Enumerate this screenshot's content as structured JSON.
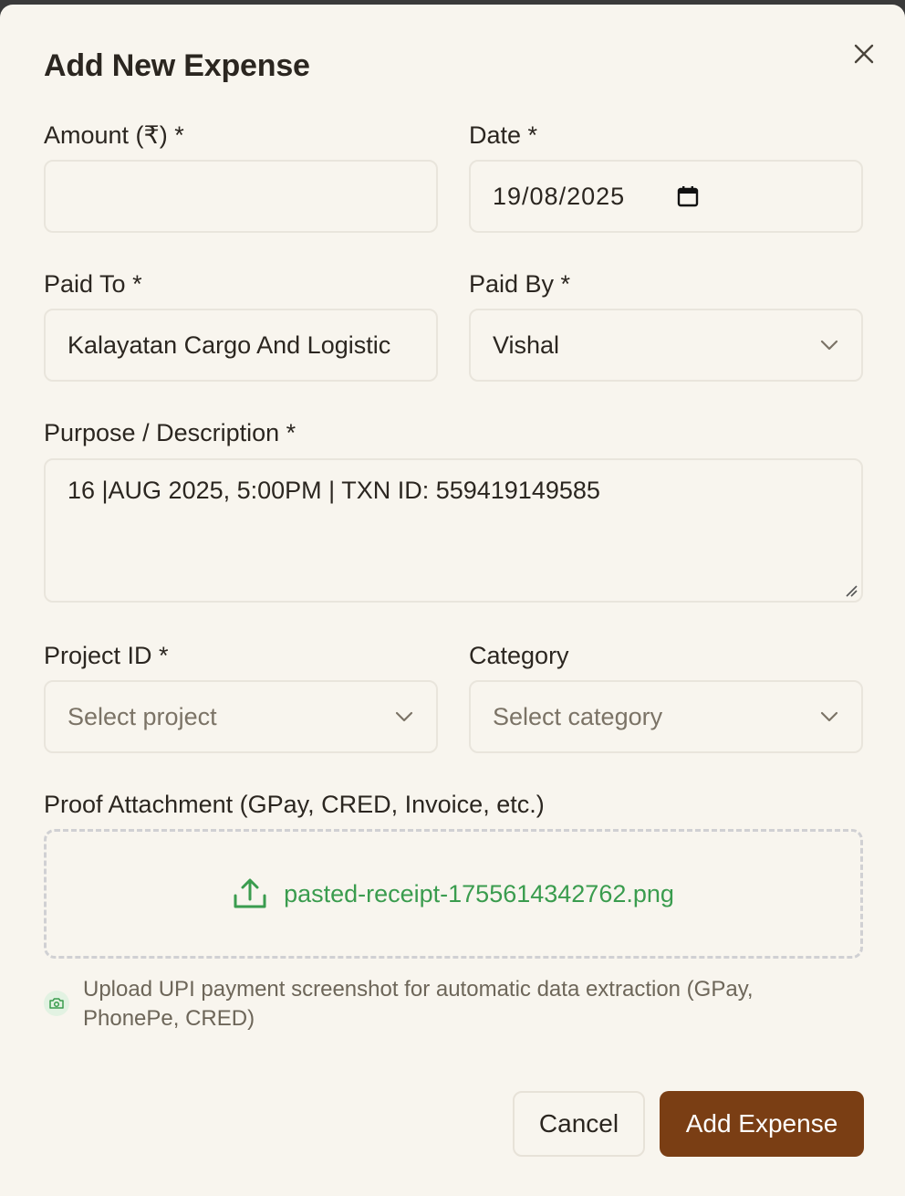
{
  "dialog": {
    "title": "Add New Expense",
    "close_icon": "close-icon"
  },
  "form": {
    "amount": {
      "label": "Amount (₹) *",
      "value": ""
    },
    "date": {
      "label": "Date *",
      "value": "19/08/2025",
      "icon": "calendar-icon"
    },
    "paid_to": {
      "label": "Paid To *",
      "value": "Kalayatan Cargo And Logistic"
    },
    "paid_by": {
      "label": "Paid By *",
      "value": "Vishal"
    },
    "purpose": {
      "label": "Purpose / Description *",
      "value": "16 |AUG 2025, 5:00PM | TXN ID: 559419149585"
    },
    "project_id": {
      "label": "Project ID *",
      "placeholder": "Select project"
    },
    "category": {
      "label": "Category",
      "placeholder": "Select category"
    },
    "proof": {
      "label": "Proof Attachment (GPay, CRED, Invoice, etc.)",
      "file_name": "pasted-receipt-1755614342762.png",
      "icon": "upload-icon",
      "hint": "Upload UPI payment screenshot for automatic data extraction (GPay, PhonePe, CRED)",
      "hint_icon": "camera-icon"
    }
  },
  "actions": {
    "cancel_label": "Cancel",
    "submit_label": "Add Expense"
  },
  "colors": {
    "background": "#f8f5ee",
    "primary": "#7a3e14",
    "success": "#3a9c4e",
    "border": "#e9e5dc"
  }
}
